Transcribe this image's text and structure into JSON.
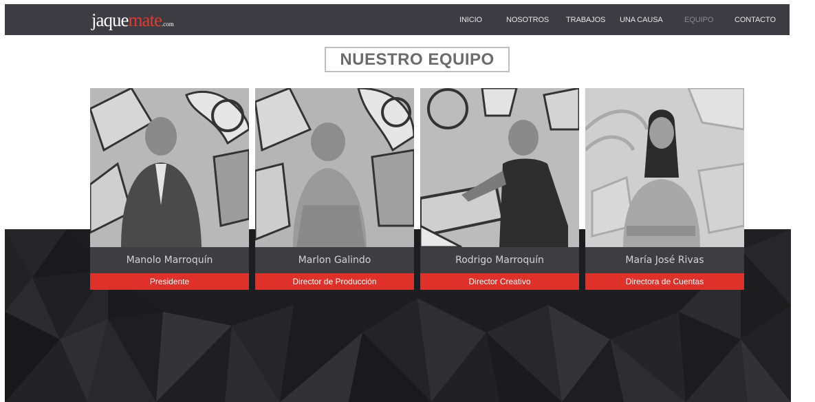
{
  "brand": {
    "logo_main": "jaque",
    "logo_accent": "mate",
    "logo_suffix": ".com"
  },
  "nav": {
    "items": [
      {
        "label": "INICIO",
        "active": false
      },
      {
        "label": "NOSOTROS",
        "active": false
      },
      {
        "label": "TRABAJOS",
        "active": false
      },
      {
        "label": "UNA CAUSA",
        "active": false
      },
      {
        "label": "EQUIPO",
        "active": true
      },
      {
        "label": "CONTACTO",
        "active": false
      }
    ]
  },
  "section": {
    "title": "NUESTRO EQUIPO"
  },
  "team": [
    {
      "name": "Manolo Marroquín",
      "role": "Presidente",
      "photo_icon": "person-photo"
    },
    {
      "name": "Marlon Galindo",
      "role": "Director de Producción",
      "photo_icon": "person-photo"
    },
    {
      "name": "Rodrigo Marroquín",
      "role": "Director Creativo",
      "photo_icon": "person-photo"
    },
    {
      "name": "María José Rivas",
      "role": "Directora de Cuentas",
      "photo_icon": "person-photo"
    }
  ],
  "colors": {
    "nav_bg": "#3d3c43",
    "accent_red": "#e0302a",
    "name_bar": "#3e3e42",
    "dark_bg": "#1d1d20"
  }
}
